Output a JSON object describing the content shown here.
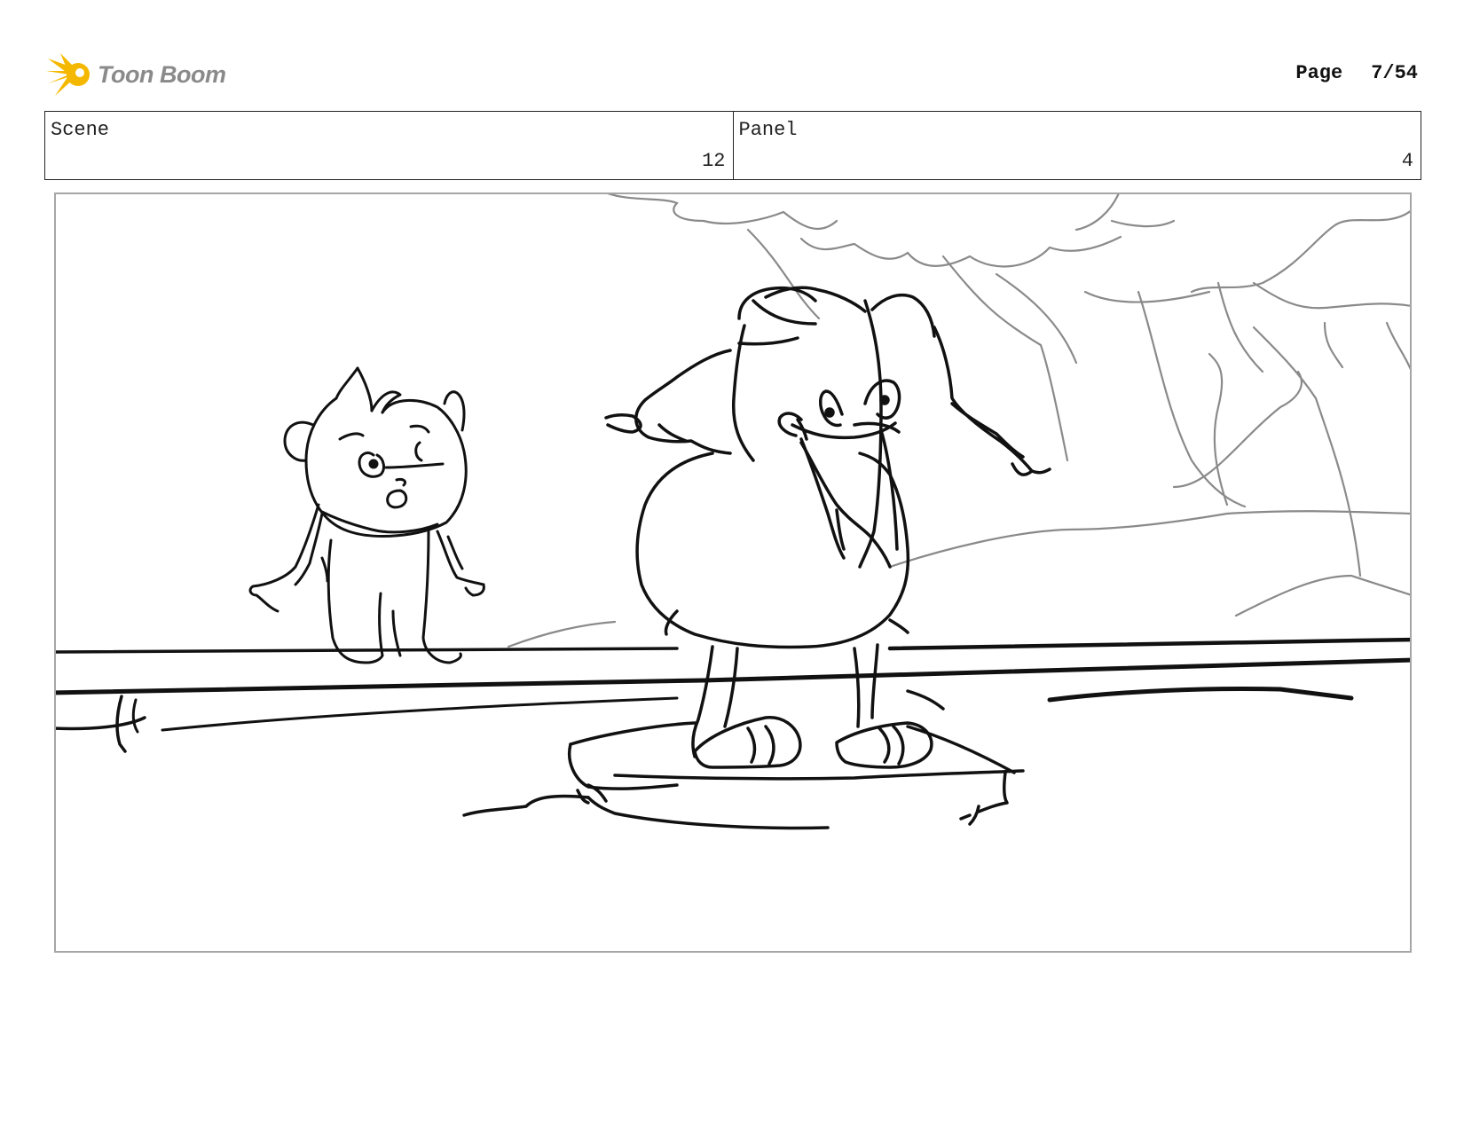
{
  "header": {
    "logo_text": "Toon Boom",
    "logo_icon": "starburst-logo-icon",
    "page_label": "Page",
    "page_number": "7/54"
  },
  "info": {
    "scene_label": "Scene",
    "scene_value": "12",
    "panel_label": "Panel",
    "panel_value": "4"
  },
  "colors": {
    "logo_yellow": "#F5B800",
    "logo_text": "#8a8a8a",
    "frame_border": "#a6a6a6",
    "ink": "#111111",
    "background_ink": "#8a8a8a"
  }
}
